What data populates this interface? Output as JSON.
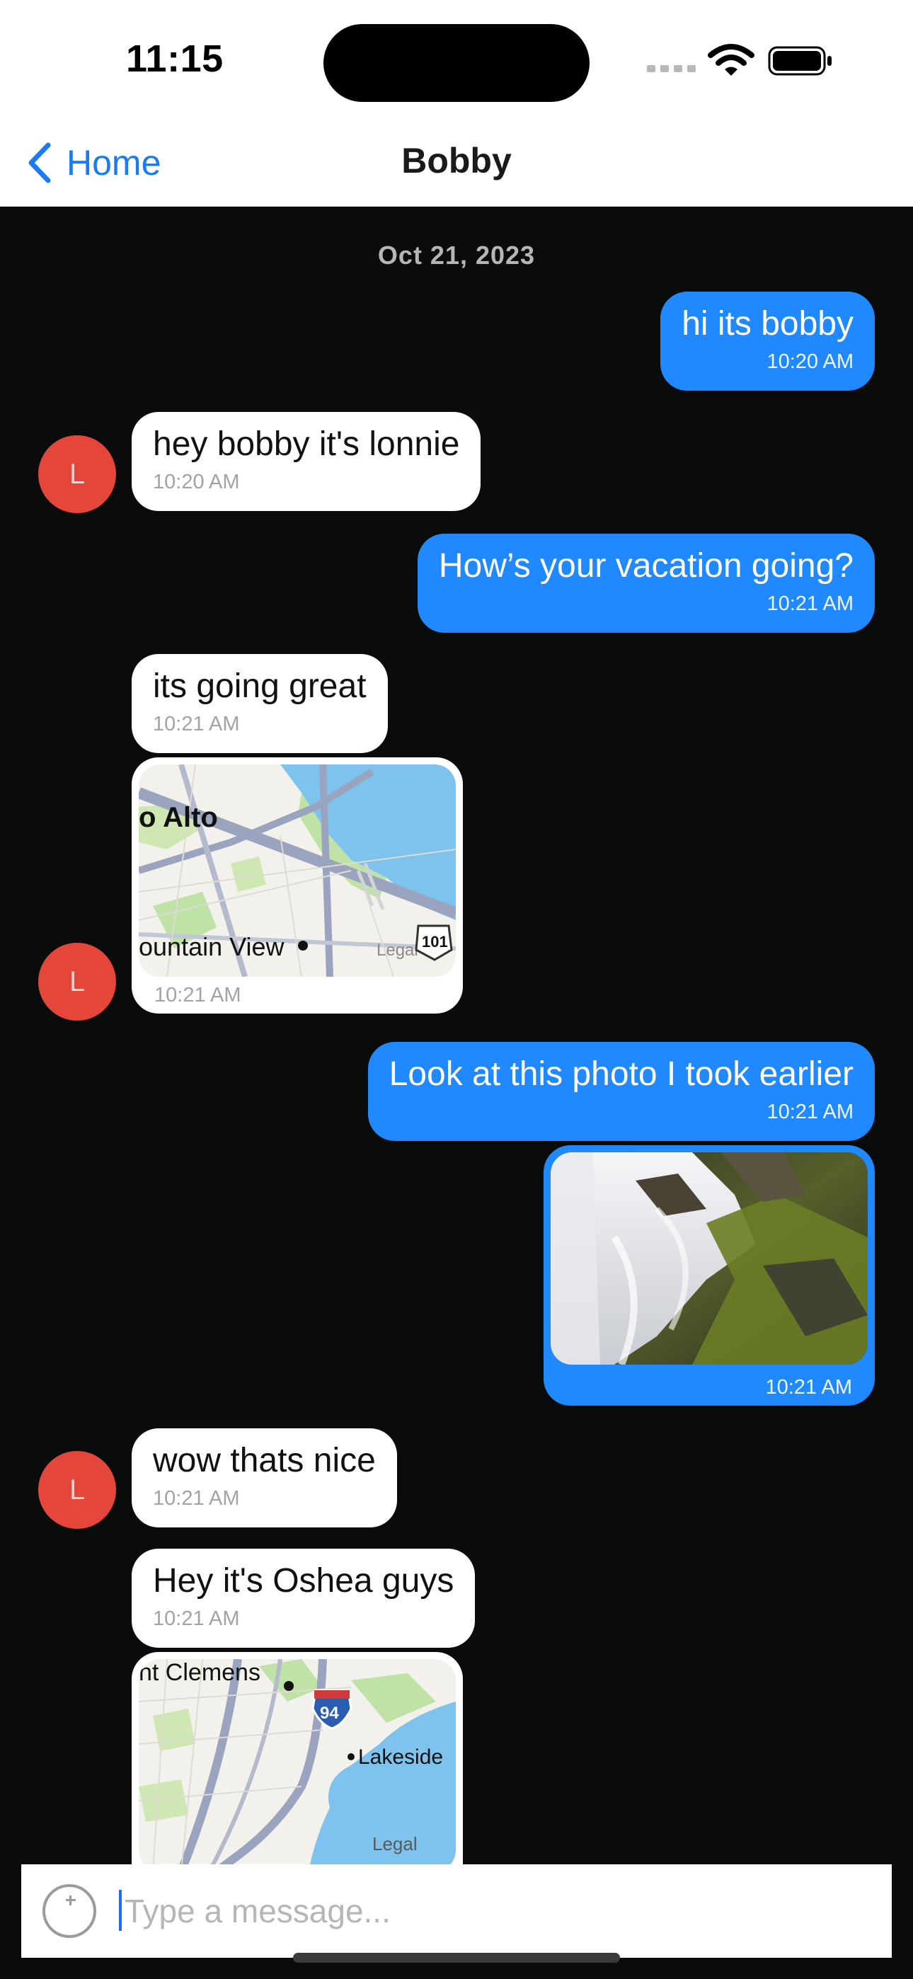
{
  "status": {
    "time": "11:15"
  },
  "nav": {
    "back_label": "Home",
    "title": "Bobby"
  },
  "chat": {
    "date": "Oct 21, 2023",
    "avatar_initial": "L",
    "messages": [
      {
        "text": "hi its bobby",
        "time": "10:20 AM"
      },
      {
        "text": "hey bobby it's lonnie",
        "time": "10:20 AM"
      },
      {
        "text": "How’s your vacation going?",
        "time": "10:21 AM"
      },
      {
        "text": "its going great",
        "time": "10:21 AM"
      },
      {
        "time": "10:21 AM",
        "map": {
          "labels": [
            "o Alto",
            "ountain View",
            "Legal",
            "101"
          ]
        }
      },
      {
        "text": "Look at this photo I took earlier",
        "time": "10:21 AM"
      },
      {
        "time": "10:21 AM"
      },
      {
        "text": "wow thats nice",
        "time": "10:21 AM"
      },
      {
        "text": "Hey it's Oshea guys",
        "time": "10:21 AM"
      },
      {
        "map": {
          "labels": [
            "nt Clemens",
            "94",
            "Lakeside",
            "Legal"
          ]
        }
      }
    ]
  },
  "composer": {
    "placeholder": "Type a message..."
  },
  "colors": {
    "accent": "#2089ff",
    "avatar": "#e4463a",
    "background": "#0a0b0b"
  }
}
